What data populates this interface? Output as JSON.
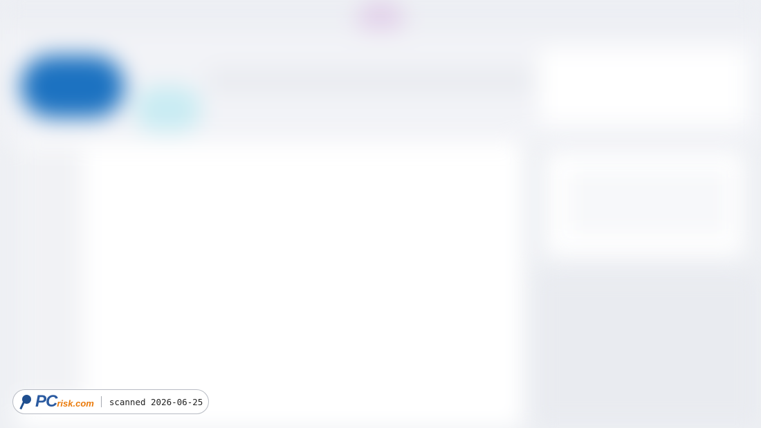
{
  "background": {
    "colors": {
      "page": "#eef0f4",
      "accent_blue": "#1c72c1",
      "accent_teal": "#c9ecf3",
      "accent_purple": "#e2d2ea",
      "panel": "#ffffff"
    }
  },
  "watermark": {
    "brand_prefix": "PC",
    "brand_suffix": "risk.com",
    "scan_text": "scanned 2026-06-25",
    "logo_icon": "magnifier-icon",
    "brand_colors": {
      "prefix": "#2a5aa0",
      "suffix": "#ea7b0c"
    }
  }
}
